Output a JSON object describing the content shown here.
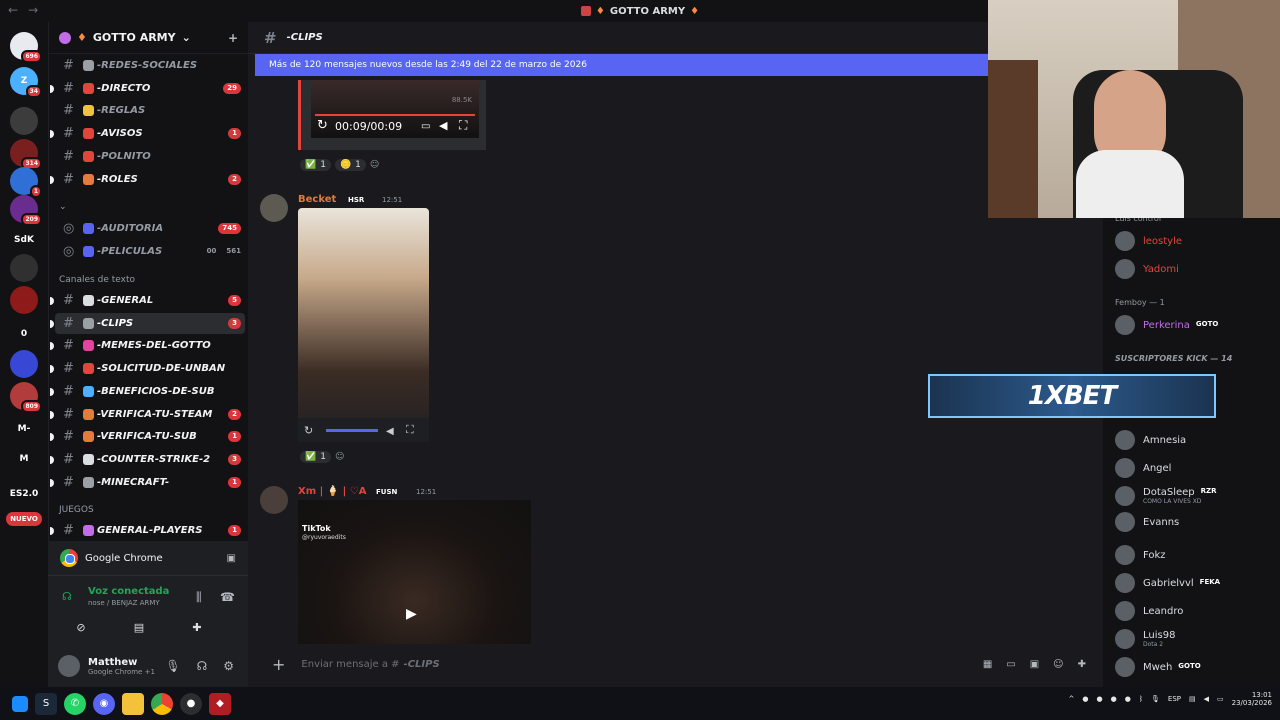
{
  "window": {
    "title": "GOTTO ARMY",
    "nav_back": "←",
    "nav_forward": "→"
  },
  "servers": [
    {
      "label": "",
      "badge": "696",
      "color": "#e8eaef"
    },
    {
      "label": "Z",
      "badge": "34",
      "color": "#4bb0ff"
    },
    {
      "label": "",
      "badge": "",
      "color": "#3c3c3c"
    },
    {
      "label": "",
      "badge": "314",
      "color": "#7a1f1f"
    },
    {
      "label": "",
      "badge": "1",
      "color": "#2f6fd6"
    },
    {
      "label": "",
      "badge": "209",
      "color": "#6a2c8f"
    },
    {
      "label": "SdK",
      "badge": "",
      "color": "#121214"
    },
    {
      "label": "",
      "badge": "",
      "color": "#303030"
    },
    {
      "label": "",
      "badge": "",
      "color": "#8e1a1a"
    },
    {
      "label": "0",
      "badge": "",
      "color": "#121214"
    },
    {
      "label": "",
      "badge": "",
      "color": "#3947d6"
    },
    {
      "label": "",
      "badge": "809",
      "color": "#b23b3b"
    },
    {
      "label": "M-",
      "badge": "",
      "color": "#121214"
    },
    {
      "label": "M",
      "badge": "",
      "color": "#121214"
    },
    {
      "label": "ES2.0",
      "badge": "",
      "color": "#121214"
    },
    {
      "label": "NUEVO",
      "badge": "",
      "color": "#da373c"
    }
  ],
  "guild": {
    "name": "GOTTO ARMY"
  },
  "channels": [
    {
      "name": "-REDES-SOCIALES",
      "badge": "",
      "bright": false,
      "emoji": "#9aa0a6"
    },
    {
      "name": "-DIRECTO",
      "badge": "29",
      "bright": true,
      "emoji": "#e2453c"
    },
    {
      "name": "-REGLAS",
      "badge": "",
      "bright": false,
      "emoji": "#f0c33c"
    },
    {
      "name": "-AVISOS",
      "badge": "1",
      "bright": true,
      "emoji": "#e2453c"
    },
    {
      "name": "-POLNITO",
      "badge": "",
      "bright": false,
      "emoji": "#e2453c"
    },
    {
      "name": "-ROLES",
      "badge": "2",
      "bright": true,
      "emoji": "#e27b3c"
    }
  ],
  "cat_emoji": {
    "label": "⌄"
  },
  "voice_channels": [
    {
      "name": "-AUDITORIA",
      "badge": "745"
    },
    {
      "name": "-PELICULAS",
      "badge": "561",
      "extra": "00"
    }
  ],
  "cat_text": {
    "label": "Canales de texto"
  },
  "text_channels": [
    {
      "name": "-GENERAL",
      "badge": "5",
      "emoji": "#dbdee1"
    },
    {
      "name": "-CLIPS",
      "badge": "3",
      "emoji": "#9aa0a6"
    },
    {
      "name": "-MEMES-DEL-GOTTO",
      "badge": "",
      "emoji": "#e2459f"
    },
    {
      "name": "-SOLICITUD-DE-UNBAN",
      "badge": "",
      "emoji": "#e2453c"
    },
    {
      "name": "-BENEFICIOS-DE-SUB",
      "badge": "",
      "emoji": "#4bb0ff"
    },
    {
      "name": "-VERIFICA-TU-STEAM",
      "badge": "2",
      "emoji": "#e27b3c"
    },
    {
      "name": "-VERIFICA-TU-SUB",
      "badge": "1",
      "emoji": "#e27b3c"
    },
    {
      "name": "-COUNTER-STRIKE-2",
      "badge": "3",
      "emoji": "#dbdee1"
    },
    {
      "name": "-MINECRAFT-",
      "badge": "1",
      "emoji": "#9aa0a6"
    }
  ],
  "cat_games": {
    "label": "JUEGOS"
  },
  "game_channels": [
    {
      "name": "GENERAL-PLAYERS",
      "badge": "1"
    }
  ],
  "chrome": {
    "label": "Google Chrome"
  },
  "voice": {
    "status": "Voz conectada",
    "sub": "nose / BENJAZ ARMY"
  },
  "user": {
    "name": "Matthew",
    "status": "Google Chrome +1"
  },
  "chat": {
    "channel": "-CLIPS",
    "banner": "Más de 120 mensajes nuevos desde las 2:49 del 22 de marzo de 2026",
    "video1": {
      "time": "00:09/00:09",
      "views": "88.5K"
    },
    "reactions1": [
      {
        "e": "✅",
        "n": "1"
      },
      {
        "e": "🪙",
        "n": "1"
      }
    ],
    "msg2": {
      "author": "Becket",
      "tag": "HSR",
      "time": "12:51"
    },
    "reactions2": [
      {
        "e": "✅",
        "n": "1"
      }
    ],
    "msg3": {
      "author": "Xm | 🍦 | ♡A",
      "tag": "FUSN",
      "time": "12:51",
      "tiktok": "TikTok",
      "handle": "@ryuvoraedits"
    },
    "composer_placeholder": "Enviar mensaje a #",
    "composer_channel": "-CLIPS"
  },
  "members": {
    "top": [
      {
        "name": "leostyle",
        "color": "#e2453c"
      },
      {
        "name": "Yadomi",
        "color": "#e2453c"
      }
    ],
    "cat1": "Femboy — 1",
    "femboy": [
      {
        "name": "Perkerina",
        "tag": "GOTO",
        "color": "#c36ce8"
      }
    ],
    "cat2": "SUSCRIPTORES KICK — 14",
    "subs": [
      {
        "name": "Amnesia",
        "tag": "",
        "sub": ""
      },
      {
        "name": "Angel",
        "tag": "",
        "sub": ""
      },
      {
        "name": "DotaSleep",
        "tag": "RZR",
        "sub": "COMO LA VIVES XD"
      },
      {
        "name": "Evanns",
        "tag": "",
        "sub": ""
      },
      {
        "name": "Fokz",
        "tag": "",
        "sub": ""
      },
      {
        "name": "Gabrielvvl",
        "tag": "FEKA",
        "sub": ""
      },
      {
        "name": "Leandro",
        "tag": "",
        "sub": ""
      },
      {
        "name": "Luis98",
        "tag": "",
        "sub": "Dota 2"
      },
      {
        "name": "Mweh",
        "tag": "GOTO",
        "sub": ""
      }
    ],
    "top_label": "Luis control"
  },
  "ad": {
    "text": "1XBET"
  },
  "taskbar": {
    "lang": "ESP",
    "time": "13:01",
    "date": "23/03/2026"
  }
}
